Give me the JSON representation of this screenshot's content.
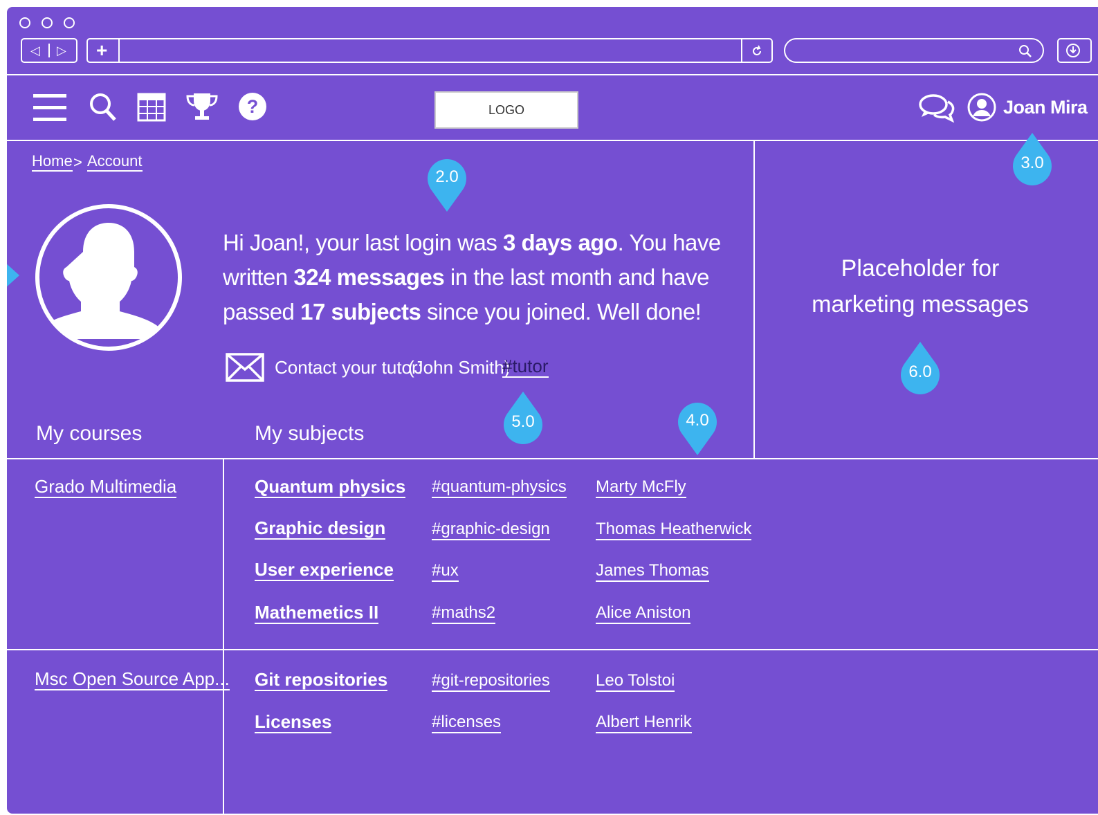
{
  "browser": {
    "nav_back": "◁",
    "nav_forward": "▷",
    "new_tab": "+"
  },
  "header": {
    "logo": "LOGO",
    "user_name": "Joan Mira"
  },
  "breadcrumb": {
    "home": "Home",
    "separator": ">",
    "account": "Account"
  },
  "welcome": {
    "part1": "Hi Joan!, your last login was ",
    "last_login": "3 days ago",
    "part2": ".  You have written ",
    "messages": "324 messages",
    "part3": " in the last month and have passed ",
    "subjects": "17 subjects",
    "part4": " since you joined. Well done!"
  },
  "tutor": {
    "label": "Contact your tutor:",
    "name": "(John Smith)",
    "tag": "#tutor"
  },
  "marketing": {
    "line1": "Placeholder for",
    "line2": "marketing messages"
  },
  "sections": {
    "courses_title": "My courses",
    "subjects_title": "My subjects"
  },
  "pins": [
    "2.0",
    "3.0",
    "6.0",
    "5.0",
    "4.0"
  ],
  "courses": [
    {
      "name": "Grado Multimedia",
      "subjects": [
        {
          "name": "Quantum physics",
          "tag": "#quantum-physics",
          "tutor": "Marty McFly"
        },
        {
          "name": "Graphic design",
          "tag": "#graphic-design",
          "tutor": "Thomas Heatherwick"
        },
        {
          "name": "User experience",
          "tag": "#ux",
          "tutor": "James Thomas"
        },
        {
          "name": "Mathemetics II",
          "tag": "#maths2",
          "tutor": "Alice Aniston"
        }
      ]
    },
    {
      "name": "Msc Open Source App...",
      "subjects": [
        {
          "name": "Git repositories",
          "tag": "#git-repositories",
          "tutor": "Leo Tolstoi"
        },
        {
          "name": "Licenses",
          "tag": "#licenses",
          "tutor": "Albert Henrik"
        }
      ]
    }
  ],
  "colors": {
    "background": "#754fd2",
    "pin": "#3db4ef",
    "tutor_tag": "#2a1a66"
  },
  "icons": [
    "menu-icon",
    "search-icon",
    "grid-icon",
    "trophy-icon",
    "help-icon",
    "chat-icon",
    "user-icon",
    "mail-icon",
    "refresh-icon",
    "download-icon"
  ]
}
